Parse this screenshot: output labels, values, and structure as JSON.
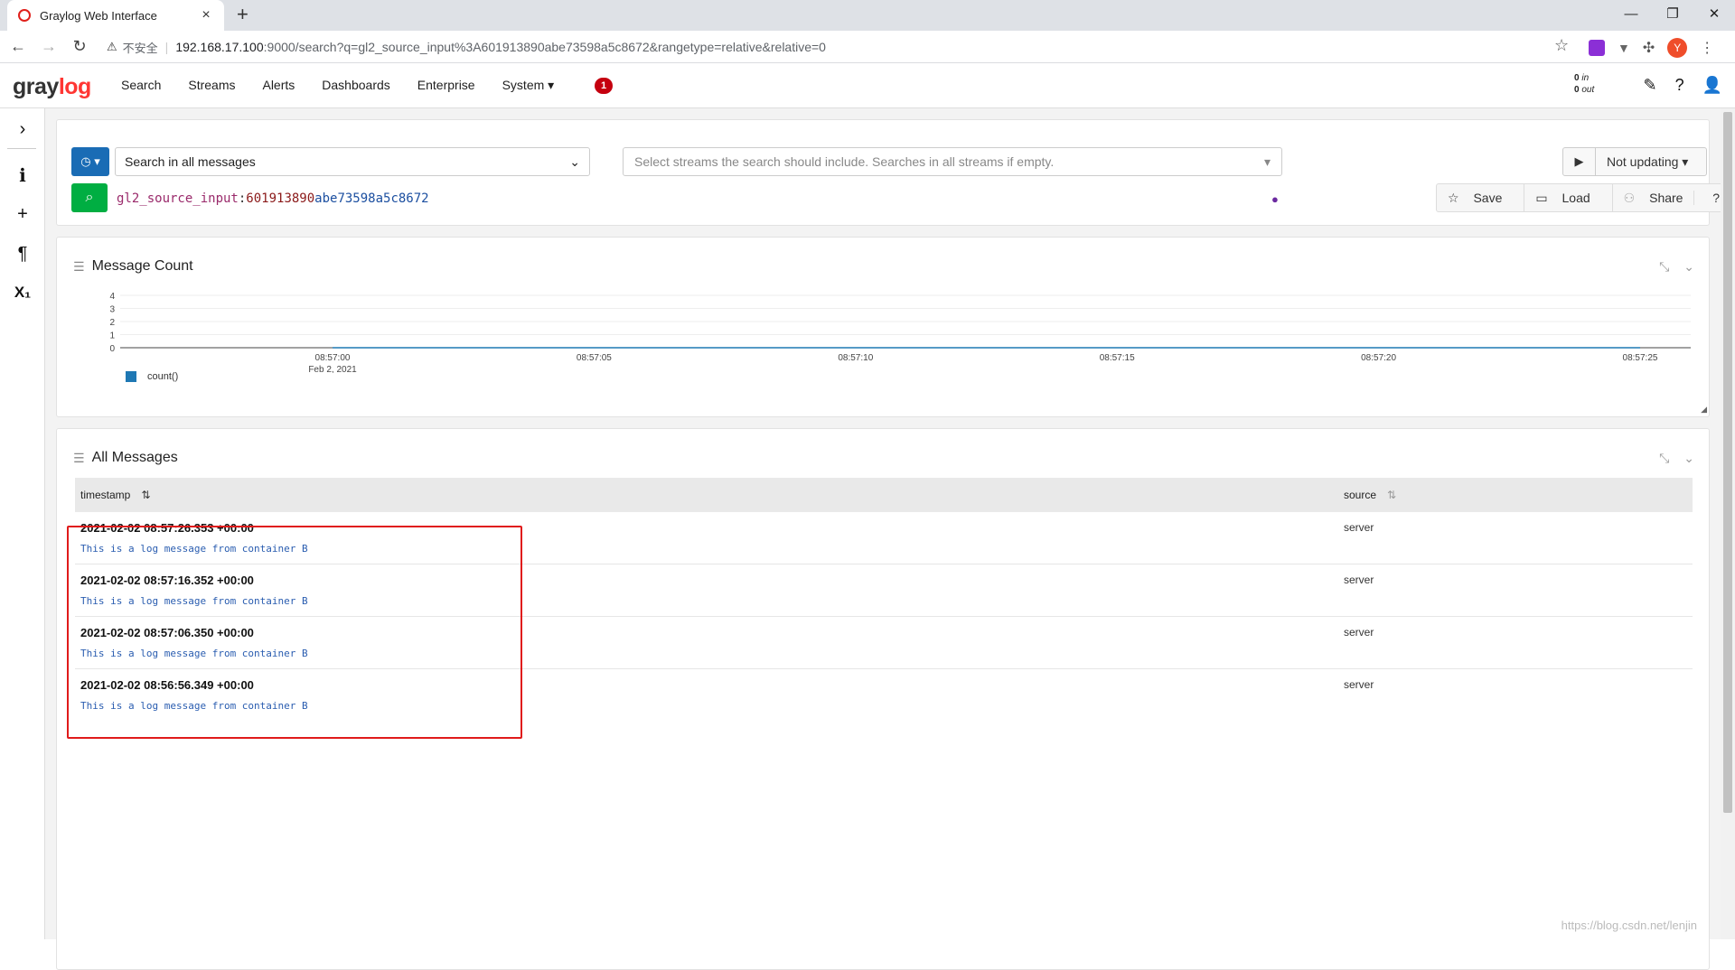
{
  "browser": {
    "tab_title": "Graylog Web Interface",
    "tab_close": "×",
    "new_tab": "+",
    "window_controls": [
      "—",
      "❐",
      "✕"
    ],
    "security_label": "不安全",
    "url_host": "192.168.17.100",
    "url_rest": ":9000/search?q=gl2_source_input%3A601913890abe73598a5c8672&rangetype=relative&relative=0",
    "avatar_letter": "Y"
  },
  "header": {
    "logo_gray": "gray",
    "logo_log": "log",
    "nav": [
      "Search",
      "Streams",
      "Alerts",
      "Dashboards",
      "Enterprise",
      "System ▾"
    ],
    "notification_count": "1",
    "throughput_in": "0",
    "throughput_in_label": "in",
    "throughput_out": "0",
    "throughput_out_label": "out"
  },
  "search_bar": {
    "scope": "Search in all messages",
    "streams_placeholder": "Select streams the search should include. Searches in all streams if empty.",
    "refresh_label": "Not updating ▾",
    "query_key": "gl2_source_input",
    "query_colon": ":",
    "query_val1": "601913890",
    "query_val2": "abe73598a5c8672",
    "save_label": "Save",
    "load_label": "Load",
    "share_label": "Share"
  },
  "message_count": {
    "title": "Message Count",
    "legend": "count()"
  },
  "chart_data": {
    "type": "line",
    "title": "Message Count",
    "x": [
      "08:57:00",
      "08:57:05",
      "08:57:10",
      "08:57:15",
      "08:57:20",
      "08:57:25"
    ],
    "x_sublabel": "Feb 2, 2021",
    "series": [
      {
        "name": "count()",
        "values": [
          0,
          0,
          0,
          0,
          0,
          0
        ]
      }
    ],
    "yticks": [
      "0",
      "1",
      "2",
      "3",
      "4"
    ],
    "ylim": [
      0,
      4
    ],
    "color": "#1f78b4",
    "grid": true
  },
  "all_messages": {
    "title": "All Messages",
    "col_timestamp": "timestamp",
    "col_source": "source",
    "rows": [
      {
        "timestamp": "2021-02-02 08:57:26.353 +00:00",
        "message": "This is a log message from container B",
        "source": "server"
      },
      {
        "timestamp": "2021-02-02 08:57:16.352 +00:00",
        "message": "This is a log message from container B",
        "source": "server"
      },
      {
        "timestamp": "2021-02-02 08:57:06.350 +00:00",
        "message": "This is a log message from container B",
        "source": "server"
      },
      {
        "timestamp": "2021-02-02 08:56:56.349 +00:00",
        "message": "This is a log message from container B",
        "source": "server"
      }
    ]
  },
  "watermark": "https://blog.csdn.net/lenjin"
}
